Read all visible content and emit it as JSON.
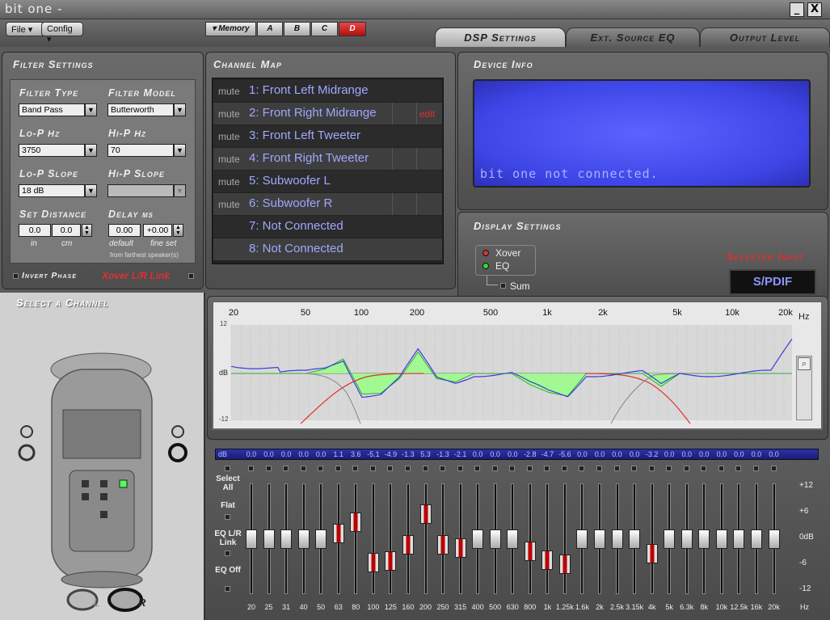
{
  "app": {
    "title": "bit one -",
    "min_label": "_",
    "close_label": "X"
  },
  "menu": {
    "file": "File",
    "config": "Config",
    "memory": "Memory",
    "presets": [
      "A",
      "B",
      "C",
      "D"
    ]
  },
  "tabs": [
    "DSP Settings",
    "Ext. Source EQ",
    "Output Level"
  ],
  "filter": {
    "title": "Filter Settings",
    "type_label": "Filter Type",
    "type_value": "Band Pass",
    "model_label": "Filter Model",
    "model_value": "Butterworth",
    "lop_label": "Lo-P",
    "lop_unit": "Hz",
    "lop_value": "3750",
    "hip_label": "Hi-P",
    "hip_unit": "Hz",
    "hip_value": "70",
    "lop_slope_label": "Lo-P Slope",
    "lop_slope_value": "18 dB",
    "hip_slope_label": "Hi-P Slope",
    "hip_slope_value": "",
    "distance_label": "Set Distance",
    "dist_in": "0.0",
    "dist_cm": "0.0",
    "in_label": "in",
    "cm_label": "cm",
    "delay_label": "Delay",
    "delay_unit": "ms",
    "delay_default": "0.00",
    "delay_fine": "+0.00",
    "default_label": "default",
    "fine_label": "fine set",
    "farthest_note": "from farthest speaker(s)",
    "invert_phase": "Invert Phase",
    "xover_link": "Xover L/R Link"
  },
  "channel_map": {
    "title": "Channel Map",
    "mute_label": "mute",
    "edit_label": "edit",
    "channels": [
      {
        "name": "1: Front Left Midrange",
        "mute": true
      },
      {
        "name": "2: Front Right Midrange",
        "mute": true
      },
      {
        "name": "3: Front Left Tweeter",
        "mute": true
      },
      {
        "name": "4: Front Right Tweeter",
        "mute": true
      },
      {
        "name": "5: Subwoofer L",
        "mute": true
      },
      {
        "name": "6: Subwoofer R",
        "mute": true
      },
      {
        "name": "7: Not Connected",
        "mute": false
      },
      {
        "name": "8: Not Connected",
        "mute": false
      }
    ]
  },
  "device_info": {
    "title": "Device Info",
    "status": "bit one not connected."
  },
  "display_settings": {
    "title": "Display Settings",
    "xover": "Xover",
    "eq": "EQ",
    "sum": "Sum",
    "selected_input_label": "Selected Input",
    "selected_input_value": "S/PDIF"
  },
  "channel_select": {
    "title": "Select a Channel",
    "left_label": "L",
    "right_label": "R"
  },
  "graph": {
    "freq_labels": [
      "20",
      "50",
      "100",
      "200",
      "500",
      "1k",
      "2k",
      "5k",
      "10k",
      "20k"
    ],
    "hz_label": "Hz",
    "y_top": "12",
    "y_mid": "dB",
    "y_bottom": "-12"
  },
  "eq": {
    "db_label": "dB",
    "select_all": "Select All",
    "flat": "Flat",
    "eq_link": "EQ L/R Link",
    "eq_off": "EQ Off",
    "scale": [
      "+12",
      "+6",
      "0dB",
      "-6",
      "-12"
    ],
    "hz_label": "Hz",
    "bands": [
      "20",
      "25",
      "31",
      "40",
      "50",
      "63",
      "80",
      "100",
      "125",
      "160",
      "200",
      "250",
      "315",
      "400",
      "500",
      "630",
      "800",
      "1k",
      "1.25k",
      "1.6k",
      "2k",
      "2.5k",
      "3.15k",
      "4k",
      "5k",
      "6.3k",
      "8k",
      "10k",
      "12.5k",
      "16k",
      "20k"
    ],
    "gains": [
      "0.0",
      "0.0",
      "0.0",
      "0.0",
      "0.0",
      "1.1",
      "3.6",
      "-5.1",
      "-4.9",
      "-1.3",
      "5.3",
      "-1.3",
      "-2.1",
      "0.0",
      "0.0",
      "0.0",
      "-2.8",
      "-4.7",
      "-5.6",
      "0.0",
      "0.0",
      "0.0",
      "0.0",
      "-3.2",
      "0.0",
      "0.0",
      "0.0",
      "0.0",
      "0.0",
      "0.0",
      "0.0"
    ]
  },
  "colors": {
    "accent": "#4f57ff",
    "red": "#e03030",
    "lcd": "#4048e8"
  }
}
